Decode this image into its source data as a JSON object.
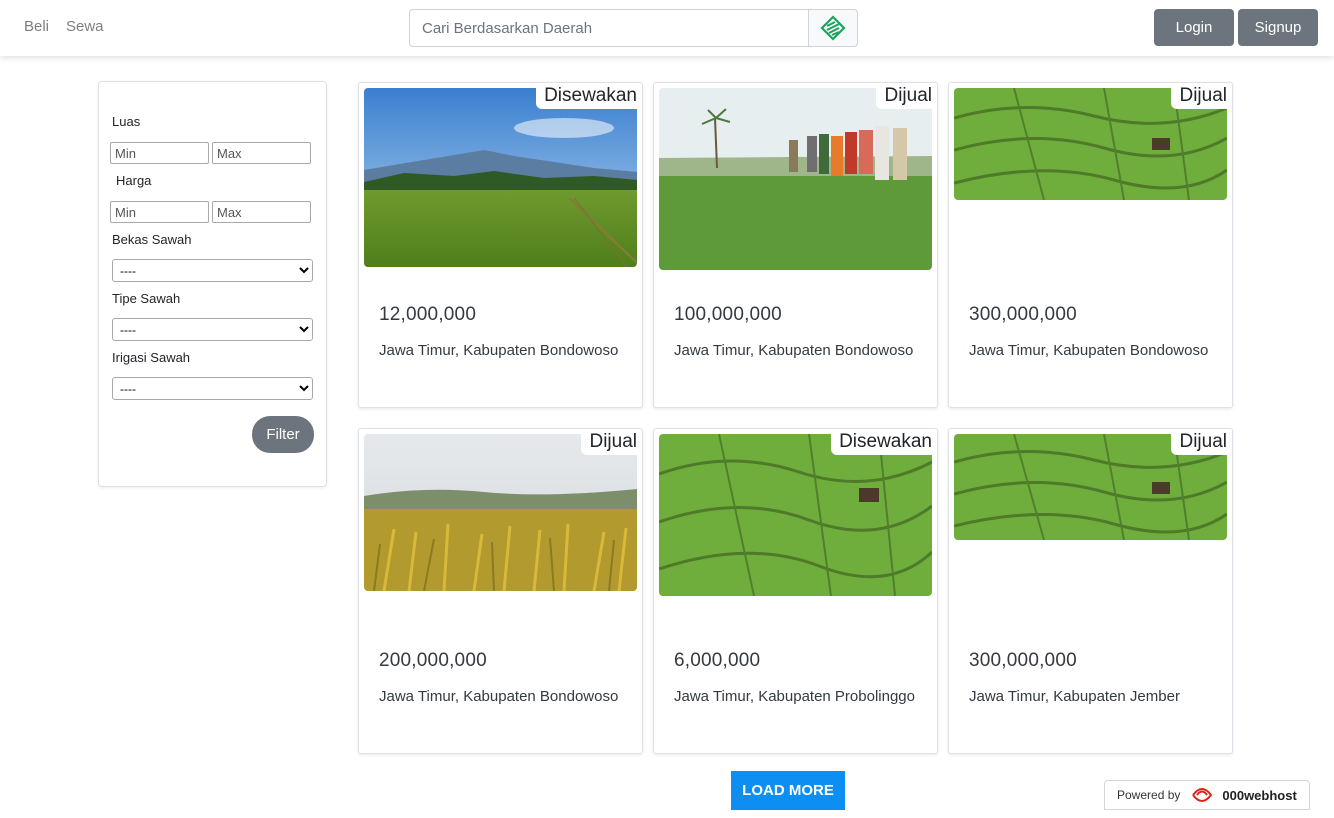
{
  "nav": {
    "beli": "Beli",
    "sewa": "Sewa",
    "search_placeholder": "Cari Berdasarkan Daerah",
    "login": "Login",
    "signup": "Signup"
  },
  "filter": {
    "luas_label": "Luas",
    "harga_label": "Harga",
    "min_placeholder": "Min",
    "max_placeholder": "Max",
    "bekas_label": "Bekas Sawah",
    "tipe_label": "Tipe Sawah",
    "irigasi_label": "Irigasi Sawah",
    "select_default": "----",
    "button": "Filter"
  },
  "listings": [
    {
      "badge": "Disewakan",
      "price": "12,000,000",
      "location": "Jawa Timur, Kabupaten Bondowoso"
    },
    {
      "badge": "Dijual",
      "price": "100,000,000",
      "location": "Jawa Timur, Kabupaten Bondowoso"
    },
    {
      "badge": "Dijual",
      "price": "300,000,000",
      "location": "Jawa Timur, Kabupaten Bondowoso"
    },
    {
      "badge": "Dijual",
      "price": "200,000,000",
      "location": "Jawa Timur, Kabupaten Bondowoso"
    },
    {
      "badge": "Disewakan",
      "price": "6,000,000",
      "location": "Jawa Timur, Kabupaten Probolinggo"
    },
    {
      "badge": "Dijual",
      "price": "300,000,000",
      "location": "Jawa Timur, Kabupaten Jember"
    }
  ],
  "load_more": "LOAD MORE",
  "powered": {
    "text": "Powered by",
    "brand": "000webhost"
  },
  "colors": {
    "primary": "#0d8ef3",
    "secondary": "#6c757d",
    "search_icon": "#1aa55c"
  }
}
